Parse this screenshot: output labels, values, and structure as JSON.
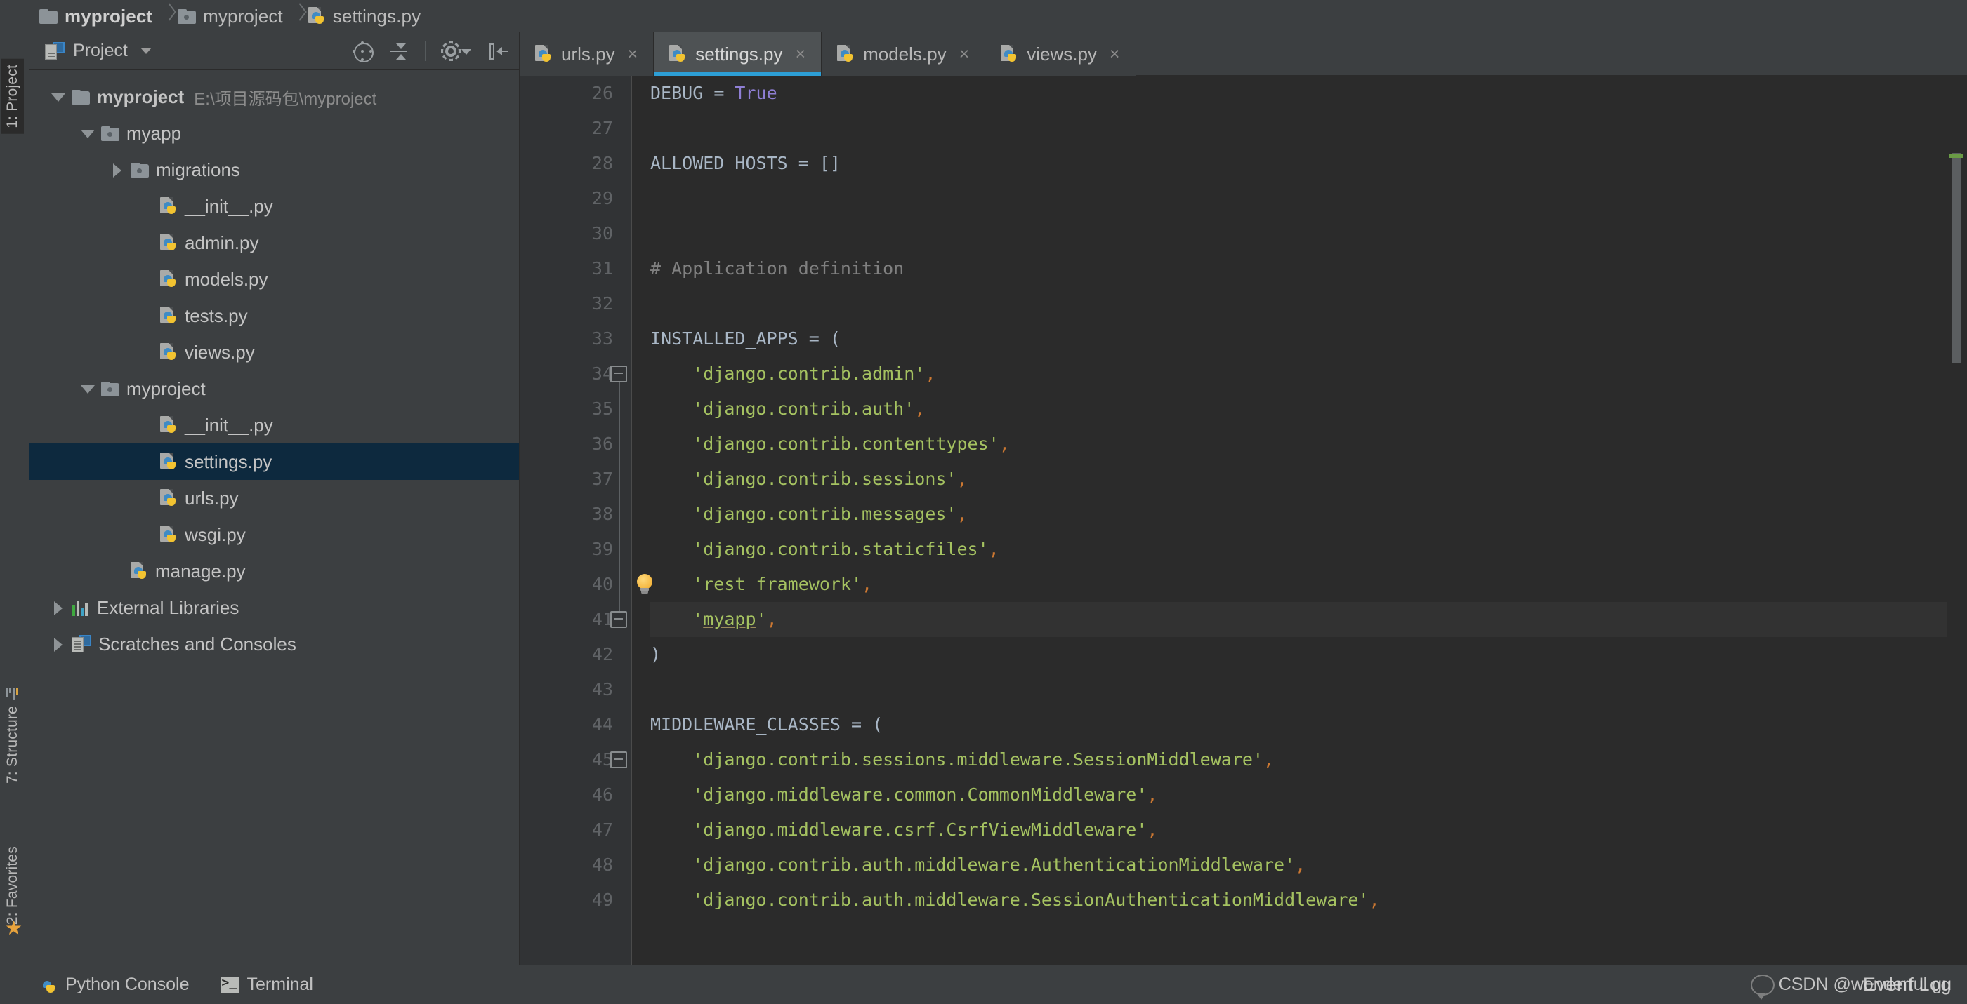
{
  "breadcrumb": {
    "items": [
      {
        "label": "myproject",
        "icon": "folder-icon",
        "bold": true
      },
      {
        "label": "myproject",
        "icon": "folder-module-icon",
        "bold": false
      },
      {
        "label": "settings.py",
        "icon": "python-file-icon",
        "bold": false
      }
    ]
  },
  "rail": {
    "project_tab": "1: Project",
    "structure_tab": "7: Structure",
    "favorites_tab": "2: Favorites",
    "star_glyph": "★"
  },
  "tool_window": {
    "title": "Project",
    "caret": "chevron-down-icon",
    "buttons": [
      {
        "name": "locate-in-tree-button",
        "icon": "crosshair-icon"
      },
      {
        "name": "collapse-all-button",
        "icon": "collapse-arrows-icon"
      },
      {
        "name": "settings-button",
        "icon": "gear-icon"
      },
      {
        "name": "hide-window-button",
        "icon": "hide-panel-icon"
      }
    ]
  },
  "tree": {
    "rows": [
      {
        "label": "myproject",
        "path": "E:\\项目源码包\\myproject",
        "icon": "folder-icon",
        "indent": 0,
        "twisty": "open",
        "bold": true,
        "selected": false
      },
      {
        "label": "myapp",
        "path": "",
        "icon": "folder-module-icon",
        "indent": 1,
        "twisty": "open",
        "bold": false,
        "selected": false
      },
      {
        "label": "migrations",
        "path": "",
        "icon": "folder-module-icon",
        "indent": 2,
        "twisty": "closed",
        "bold": false,
        "selected": false
      },
      {
        "label": "__init__.py",
        "path": "",
        "icon": "python-file-icon",
        "indent": 3,
        "twisty": "none",
        "bold": false,
        "selected": false
      },
      {
        "label": "admin.py",
        "path": "",
        "icon": "python-file-icon",
        "indent": 3,
        "twisty": "none",
        "bold": false,
        "selected": false
      },
      {
        "label": "models.py",
        "path": "",
        "icon": "python-file-icon",
        "indent": 3,
        "twisty": "none",
        "bold": false,
        "selected": false
      },
      {
        "label": "tests.py",
        "path": "",
        "icon": "python-file-icon",
        "indent": 3,
        "twisty": "none",
        "bold": false,
        "selected": false
      },
      {
        "label": "views.py",
        "path": "",
        "icon": "python-file-icon",
        "indent": 3,
        "twisty": "none",
        "bold": false,
        "selected": false
      },
      {
        "label": "myproject",
        "path": "",
        "icon": "folder-module-icon",
        "indent": 1,
        "twisty": "open",
        "bold": false,
        "selected": false
      },
      {
        "label": "__init__.py",
        "path": "",
        "icon": "python-file-icon",
        "indent": 3,
        "twisty": "none",
        "bold": false,
        "selected": false
      },
      {
        "label": "settings.py",
        "path": "",
        "icon": "python-file-icon",
        "indent": 3,
        "twisty": "none",
        "bold": false,
        "selected": true
      },
      {
        "label": "urls.py",
        "path": "",
        "icon": "python-file-icon",
        "indent": 3,
        "twisty": "none",
        "bold": false,
        "selected": false
      },
      {
        "label": "wsgi.py",
        "path": "",
        "icon": "python-file-icon",
        "indent": 3,
        "twisty": "none",
        "bold": false,
        "selected": false
      },
      {
        "label": "manage.py",
        "path": "",
        "icon": "python-file-icon",
        "indent": 2,
        "twisty": "none",
        "bold": false,
        "selected": false
      },
      {
        "label": "External Libraries",
        "path": "",
        "icon": "libraries-icon",
        "indent": 0,
        "twisty": "closed",
        "bold": false,
        "selected": false
      },
      {
        "label": "Scratches and Consoles",
        "path": "",
        "icon": "scratches-icon",
        "indent": 0,
        "twisty": "closed",
        "bold": false,
        "selected": false
      }
    ]
  },
  "editor": {
    "tabs": [
      {
        "label": "urls.py",
        "active": false,
        "close": "×"
      },
      {
        "label": "settings.py",
        "active": true,
        "close": "×"
      },
      {
        "label": "models.py",
        "active": false,
        "close": "×"
      },
      {
        "label": "views.py",
        "active": false,
        "close": "×"
      }
    ],
    "first_line_number": 26,
    "lines": [
      {
        "n": 26,
        "tokens": [
          {
            "t": "DEBUG ",
            "c": "idn"
          },
          {
            "t": "= ",
            "c": "idn"
          },
          {
            "t": "True",
            "c": "kw"
          }
        ]
      },
      {
        "n": 27,
        "tokens": []
      },
      {
        "n": 28,
        "tokens": [
          {
            "t": "ALLOWED_HOSTS = []",
            "c": "idn"
          }
        ]
      },
      {
        "n": 29,
        "tokens": []
      },
      {
        "n": 30,
        "tokens": []
      },
      {
        "n": 31,
        "tokens": [
          {
            "t": "# Application definition",
            "c": "cmt"
          }
        ]
      },
      {
        "n": 32,
        "tokens": []
      },
      {
        "n": 33,
        "tokens": [
          {
            "t": "INSTALLED_APPS = (",
            "c": "idn"
          }
        ]
      },
      {
        "n": 34,
        "tokens": [
          {
            "t": "    'django.contrib.admin'",
            "c": "str"
          },
          {
            "t": ",",
            "c": "pun"
          }
        ]
      },
      {
        "n": 35,
        "tokens": [
          {
            "t": "    'django.contrib.auth'",
            "c": "str"
          },
          {
            "t": ",",
            "c": "pun"
          }
        ]
      },
      {
        "n": 36,
        "tokens": [
          {
            "t": "    'django.contrib.contenttypes'",
            "c": "str"
          },
          {
            "t": ",",
            "c": "pun"
          }
        ]
      },
      {
        "n": 37,
        "tokens": [
          {
            "t": "    'django.contrib.sessions'",
            "c": "str"
          },
          {
            "t": ",",
            "c": "pun"
          }
        ]
      },
      {
        "n": 38,
        "tokens": [
          {
            "t": "    'django.contrib.messages'",
            "c": "str"
          },
          {
            "t": ",",
            "c": "pun"
          }
        ]
      },
      {
        "n": 39,
        "tokens": [
          {
            "t": "    'django.contrib.staticfiles'",
            "c": "str"
          },
          {
            "t": ",",
            "c": "pun"
          }
        ]
      },
      {
        "n": 40,
        "tokens": [
          {
            "t": "    'rest_framework'",
            "c": "str"
          },
          {
            "t": ",",
            "c": "pun"
          }
        ]
      },
      {
        "n": 41,
        "tokens": [
          {
            "t": "    '",
            "c": "str"
          },
          {
            "t": "myapp",
            "c": "str und"
          },
          {
            "t": "'",
            "c": "str"
          },
          {
            "t": ",",
            "c": "pun"
          }
        ],
        "highlight": true
      },
      {
        "n": 42,
        "tokens": [
          {
            "t": ")",
            "c": "idn"
          }
        ]
      },
      {
        "n": 43,
        "tokens": []
      },
      {
        "n": 44,
        "tokens": [
          {
            "t": "MIDDLEWARE_CLASSES = (",
            "c": "idn"
          }
        ]
      },
      {
        "n": 45,
        "tokens": [
          {
            "t": "    'django.contrib.sessions.middleware.SessionMiddleware'",
            "c": "str"
          },
          {
            "t": ",",
            "c": "pun"
          }
        ]
      },
      {
        "n": 46,
        "tokens": [
          {
            "t": "    'django.middleware.common.CommonMiddleware'",
            "c": "str"
          },
          {
            "t": ",",
            "c": "pun"
          }
        ]
      },
      {
        "n": 47,
        "tokens": [
          {
            "t": "    'django.middleware.csrf.CsrfViewMiddleware'",
            "c": "str"
          },
          {
            "t": ",",
            "c": "pun"
          }
        ]
      },
      {
        "n": 48,
        "tokens": [
          {
            "t": "    'django.contrib.auth.middleware.AuthenticationMiddleware'",
            "c": "str"
          },
          {
            "t": ",",
            "c": "pun"
          }
        ]
      },
      {
        "n": 49,
        "tokens": [
          {
            "t": "    'django.contrib.auth.middleware.SessionAuthenticationMiddleware'",
            "c": "str"
          },
          {
            "t": ",",
            "c": "pun"
          }
        ]
      }
    ],
    "inspection_bulb_line": 40,
    "fold_markers": [
      34,
      41,
      45
    ]
  },
  "status_bar": {
    "python_console": "Python Console",
    "terminal": "Terminal",
    "event_log": "Event Log"
  },
  "watermark": {
    "text": "CSDN @wonderful gu"
  },
  "colors": {
    "accent": "#2d9fd6",
    "selection": "#0d293e",
    "string": "#a5c261",
    "keyword": "#8f7fd4",
    "comment": "#808080",
    "punct": "#cc7832",
    "editor_bg": "#2b2b2b",
    "chrome_bg": "#3c3f41"
  }
}
